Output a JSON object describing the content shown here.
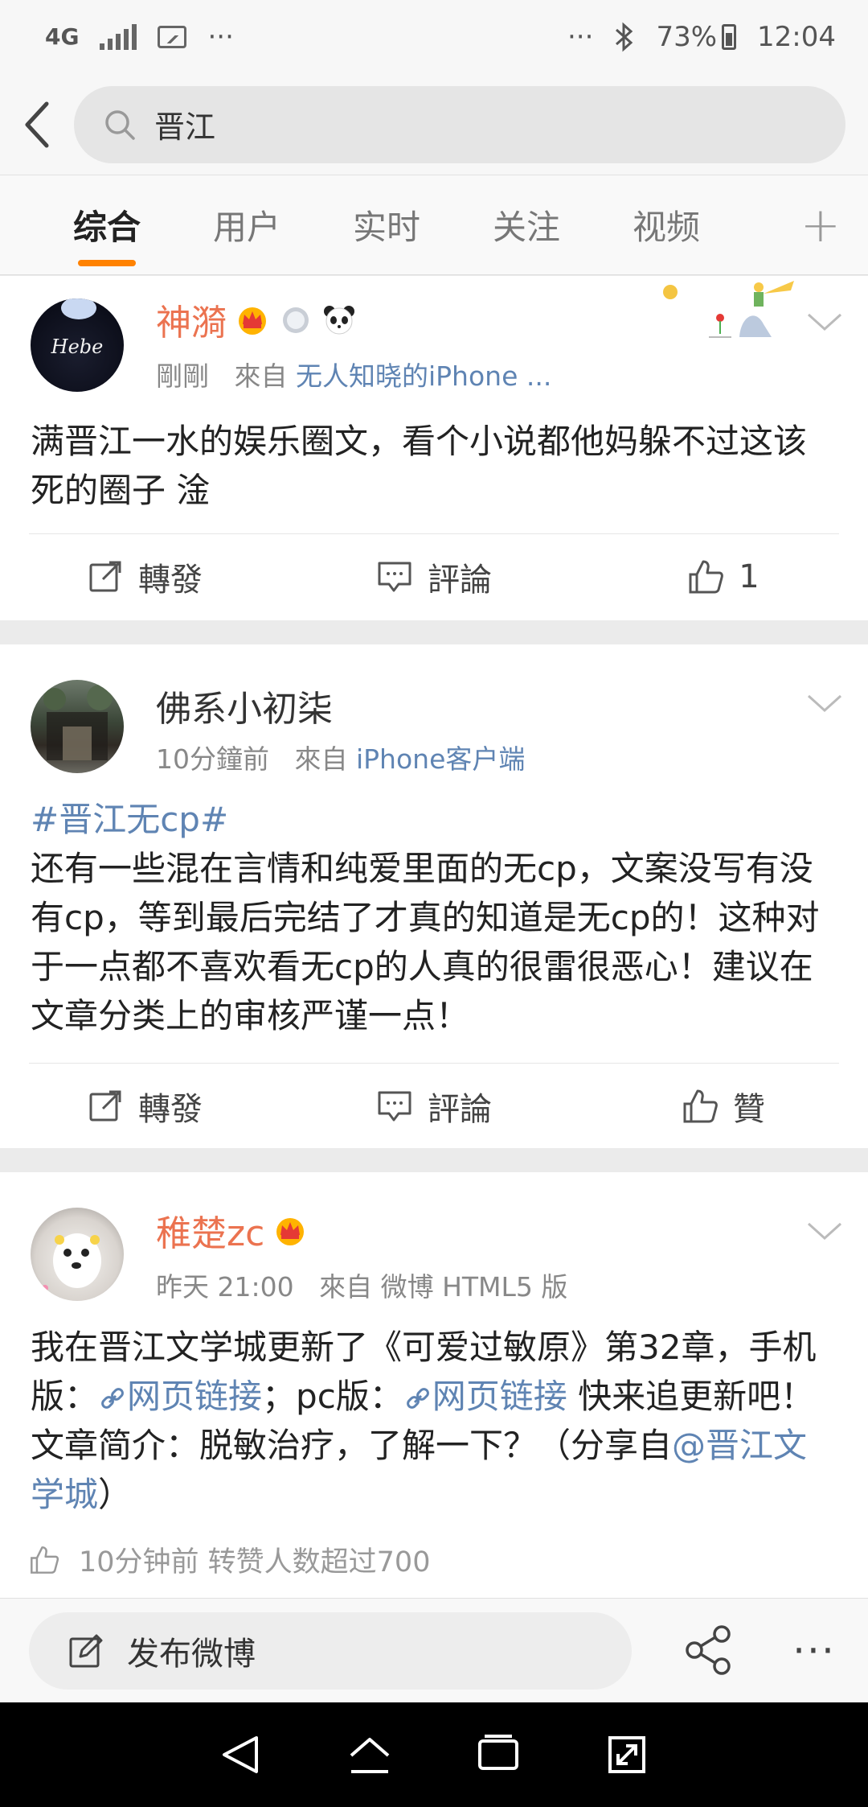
{
  "status_bar": {
    "network": "4G",
    "more_dots": "···",
    "right_dots": "···",
    "battery_text": "73%",
    "time": "12:04"
  },
  "search": {
    "query": "晋江"
  },
  "tabs": [
    {
      "label": "综合",
      "active": true
    },
    {
      "label": "用户",
      "active": false
    },
    {
      "label": "实时",
      "active": false
    },
    {
      "label": "关注",
      "active": false
    },
    {
      "label": "视频",
      "active": false
    }
  ],
  "tab_add": "+",
  "posts": [
    {
      "user": "神漪",
      "time": "剛剛",
      "from_label": "來自",
      "source": "无人知晓的iPhone ...",
      "text": "满晋江一水的娱乐圈文，看个小说都他妈躲不过这该死的圈子 淦",
      "actions": {
        "repost": "轉發",
        "comment": "評論",
        "like": "1"
      }
    },
    {
      "user": "佛系小初柒",
      "time": "10分鐘前",
      "from_label": "來自",
      "source": "iPhone客户端",
      "hashtag": "#晋江无cp#",
      "text": "还有一些混在言情和纯爱里面的无cp，文案没写有没有cp，等到最后完结了才真的知道是无cp的！这种对于一点都不喜欢看无cp的人真的很雷很恶心！建议在文章分类上的审核严谨一点！",
      "actions": {
        "repost": "轉發",
        "comment": "評論",
        "like": "贊"
      }
    },
    {
      "user": "稚楚zc",
      "time": "昨天 21:00",
      "from_label": "來自",
      "source": "微博 HTML5 版",
      "text_part1": "我在晋江文学城更新了《可爱过敏原》第32章，手机版：",
      "link1": "网页链接",
      "text_part2": "；pc版：",
      "link2": "网页链接",
      "text_part3": " 快来追更新吧！文章简介：脱敏治疗，了解一下？（分享自",
      "mention": "@晋江文学城",
      "text_part4": "）",
      "footer": "10分钟前 转赞人数超过700"
    }
  ],
  "compose": {
    "label": "发布微博",
    "more": "···"
  }
}
